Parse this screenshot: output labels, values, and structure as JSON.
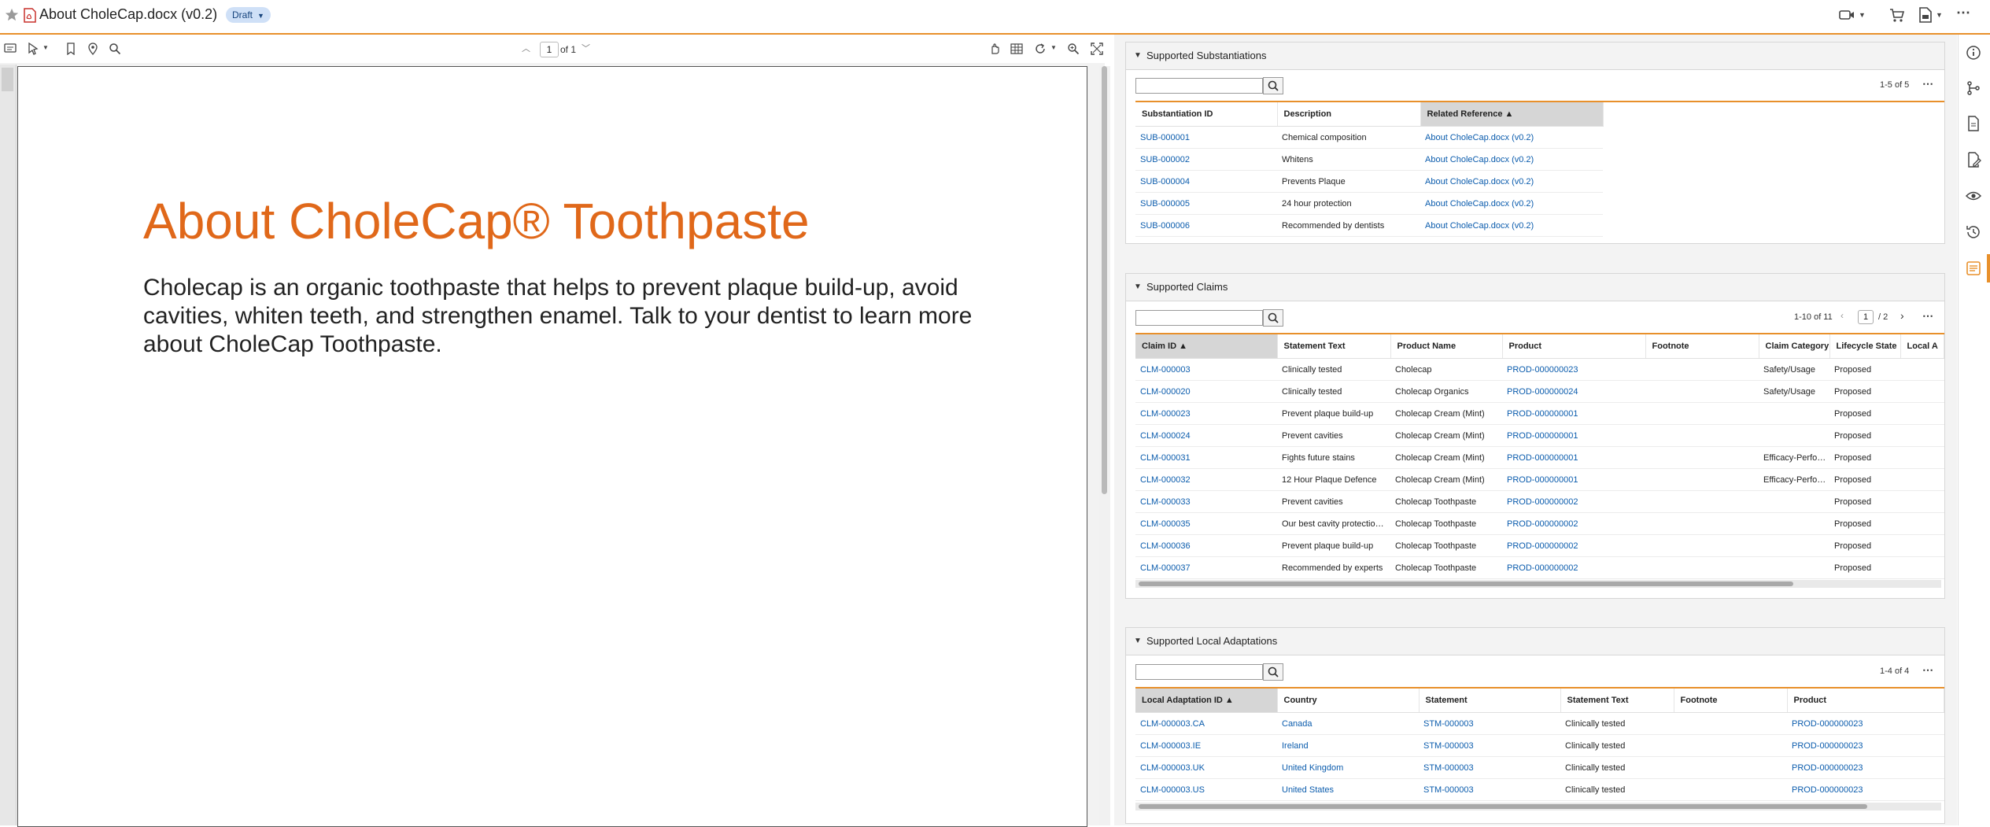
{
  "header": {
    "title": "About CholeCap.docx (v0.2)",
    "status_badge": "Draft",
    "icons": [
      "star-icon",
      "pdf-icon",
      "video-icon",
      "cart-icon",
      "document-menu-icon",
      "more-icon"
    ]
  },
  "viewer": {
    "toolbar_icons": [
      "comment-icon",
      "pointer-icon",
      "bookmark-icon",
      "pin-icon",
      "search-icon",
      "hand-icon",
      "grid-icon",
      "rotate-icon",
      "zoom-in-icon",
      "fullscreen-icon"
    ],
    "page_current": "1",
    "page_of": "of 1"
  },
  "document": {
    "heading": "About CholeCap® Toothpaste",
    "body": "Cholecap is an organic toothpaste that helps to prevent plaque build-up, avoid cavities, whiten teeth, and strengthen enamel. Talk to your dentist to learn more about CholeCap Toothpaste."
  },
  "substantiations": {
    "title": "Supported Substantiations",
    "count": "1-5 of 5",
    "columns": [
      "Substantiation ID",
      "Description",
      "Related Reference ▲"
    ],
    "rows": [
      [
        "SUB-000001",
        "Chemical composition",
        "About CholeCap.docx (v0.2)"
      ],
      [
        "SUB-000002",
        "Whitens",
        "About CholeCap.docx (v0.2)"
      ],
      [
        "SUB-000004",
        "Prevents Plaque",
        "About CholeCap.docx (v0.2)"
      ],
      [
        "SUB-000005",
        "24 hour protection",
        "About CholeCap.docx (v0.2)"
      ],
      [
        "SUB-000006",
        "Recommended by dentists",
        "About CholeCap.docx (v0.2)"
      ]
    ]
  },
  "claims": {
    "title": "Supported Claims",
    "count": "1-10 of 11",
    "page_current": "1",
    "page_total": "/ 2",
    "columns": [
      "Claim ID ▲",
      "Statement Text",
      "Product Name",
      "Product",
      "Footnote",
      "Claim Category",
      "Lifecycle State",
      "Local A"
    ],
    "rows": [
      [
        "CLM-000003",
        "Clinically tested",
        "Cholecap",
        "PROD-000000023",
        "",
        "Safety/Usage",
        "Proposed",
        ""
      ],
      [
        "CLM-000020",
        "Clinically tested",
        "Cholecap Organics",
        "PROD-000000024",
        "",
        "Safety/Usage",
        "Proposed",
        ""
      ],
      [
        "CLM-000023",
        "Prevent plaque build-up",
        "Cholecap Cream (Mint)",
        "PROD-000000001",
        "",
        "",
        "Proposed",
        ""
      ],
      [
        "CLM-000024",
        "Prevent cavities",
        "Cholecap Cream (Mint)",
        "PROD-000000001",
        "",
        "",
        "Proposed",
        ""
      ],
      [
        "CLM-000031",
        "Fights future stains",
        "Cholecap Cream (Mint)",
        "PROD-000000001",
        "",
        "Efficacy-Perfo…",
        "Proposed",
        ""
      ],
      [
        "CLM-000032",
        "12 Hour Plaque Defence",
        "Cholecap Cream (Mint)",
        "PROD-000000001",
        "",
        "Efficacy-Perfo…",
        "Proposed",
        ""
      ],
      [
        "CLM-000033",
        "Prevent cavities",
        "Cholecap Toothpaste",
        "PROD-000000002",
        "",
        "",
        "Proposed",
        ""
      ],
      [
        "CLM-000035",
        "Our best cavity protectio…",
        "Cholecap Toothpaste",
        "PROD-000000002",
        "",
        "",
        "Proposed",
        ""
      ],
      [
        "CLM-000036",
        "Prevent plaque build-up",
        "Cholecap Toothpaste",
        "PROD-000000002",
        "",
        "",
        "Proposed",
        ""
      ],
      [
        "CLM-000037",
        "Recommended by experts",
        "Cholecap Toothpaste",
        "PROD-000000002",
        "",
        "",
        "Proposed",
        ""
      ]
    ]
  },
  "adaptations": {
    "title": "Supported Local Adaptations",
    "count": "1-4 of 4",
    "columns": [
      "Local Adaptation ID ▲",
      "Country",
      "Statement",
      "Statement Text",
      "Footnote",
      "Product"
    ],
    "rows": [
      [
        "CLM-000003.CA",
        "Canada",
        "STM-000003",
        "Clinically tested",
        "",
        "PROD-000000023"
      ],
      [
        "CLM-000003.IE",
        "Ireland",
        "STM-000003",
        "Clinically tested",
        "",
        "PROD-000000023"
      ],
      [
        "CLM-000003.UK",
        "United Kingdom",
        "STM-000003",
        "Clinically tested",
        "",
        "PROD-000000023"
      ],
      [
        "CLM-000003.US",
        "United States",
        "STM-000003",
        "Clinically tested",
        "",
        "PROD-000000023"
      ]
    ]
  },
  "rail_icons": [
    "info-icon",
    "workflow-icon",
    "document-icon",
    "edit-document-icon",
    "eye-icon",
    "history-icon",
    "annotations-icon"
  ],
  "colors": {
    "accent": "#e8902b",
    "heading": "#e0681a",
    "link": "#0b5cad",
    "badge_bg": "#cfe0f7"
  }
}
